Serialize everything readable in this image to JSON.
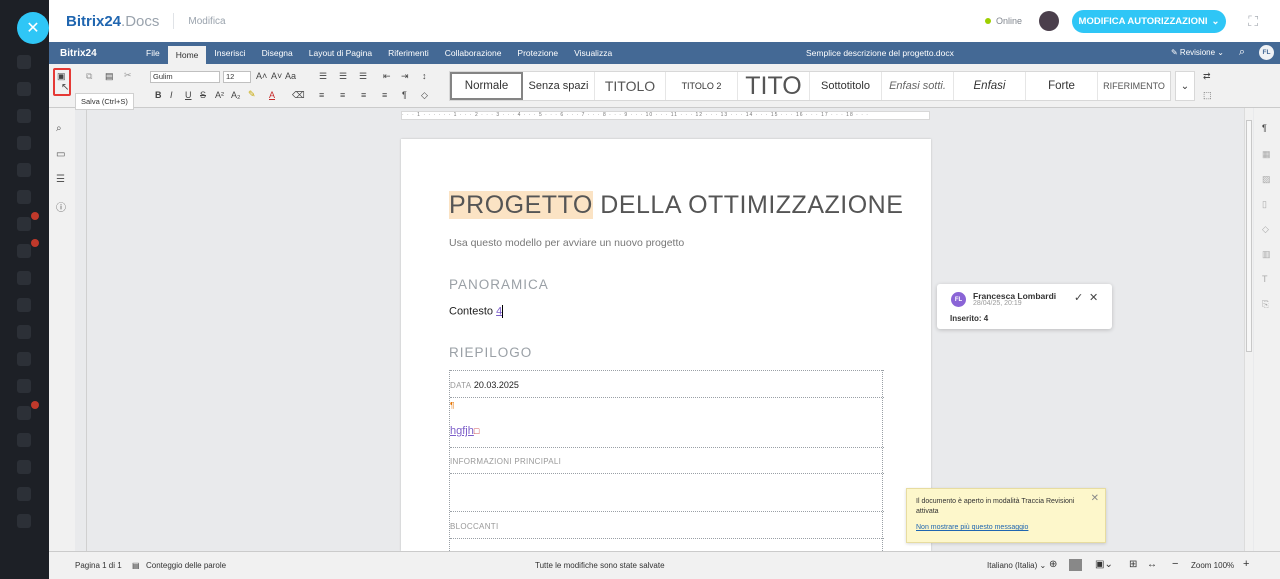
{
  "header": {
    "brand_name": "Bitrix24",
    "brand_suffix": ".Docs",
    "mode": "Modifica",
    "status": "Online",
    "permissions_button": "MODIFICA AUTORIZZAZIONI"
  },
  "menubar": {
    "logo": "Bitrix24",
    "items": [
      "File",
      "Home",
      "Inserisci",
      "Disegna",
      "Layout di Pagina",
      "Riferimenti",
      "Collaborazione",
      "Protezione",
      "Visualizza"
    ],
    "active_index": 1,
    "doc_title": "Semplice descrizione del progetto.docx",
    "review": "Revisione",
    "user_initials": "FL"
  },
  "toolbar": {
    "save_tooltip": "Salva (Ctrl+S)",
    "font": "Gulim",
    "size": "12",
    "styles": [
      "Normale",
      "Senza spazi",
      "TITOLO",
      "TITOLO 2",
      "TITO",
      "Sottotitolo",
      "Enfasi sotti.",
      "Enfasi",
      "Forte",
      "RIFERIMENTO"
    ],
    "ruler_marks": "· · · 1 · · · ·  · · 1 · · · 2 · · · 3 · · · 4 · · · 5 · · · 6 · · · 7 · · · 8 · · · 9 · · · 10 · · · 11 · · · 12 · · · 13 · · · 14 · · · 15 · · · 16 · · · 17 · · · 18 · · ·"
  },
  "document": {
    "title_highlight": "PROGETTO",
    "title_rest": " DELLA OTTIMIZZAZIONE",
    "subtitle": "Usa questo modello per avviare un nuovo progetto",
    "section1": "PANORAMICA",
    "context_label": "Contesto",
    "context_insert": "4",
    "section2": "RIEPILOGO",
    "date_label": "DATA",
    "date_value": "20.03.2025",
    "pilcrow": "¶",
    "inserted_text": "hgfjh",
    "info_label": "INFORMAZIONI PRINCIPALI",
    "blockers_label": "BLOCCANTI"
  },
  "comment": {
    "initials": "FL",
    "author": "Francesca Lombardi",
    "date": "28/04/25, 20:19",
    "text": "Inserito: 4"
  },
  "notice": {
    "text": "Il documento è aperto in modalità Traccia Revisioni attivata",
    "link": "Non mostrare più questo messaggio"
  },
  "statusbar": {
    "page": "Pagina 1 di 1",
    "word_count": "Conteggio delle parole",
    "saved": "Tutte le modifiche sono state salvate",
    "language": "Italiano (Italia)",
    "zoom": "Zoom 100%"
  },
  "colors": {
    "accent": "#2fc6f6",
    "menubar": "#446995",
    "highlight": "#fbe3c4",
    "insertion": "#7c5ec9",
    "save_outline": "#e53935"
  }
}
